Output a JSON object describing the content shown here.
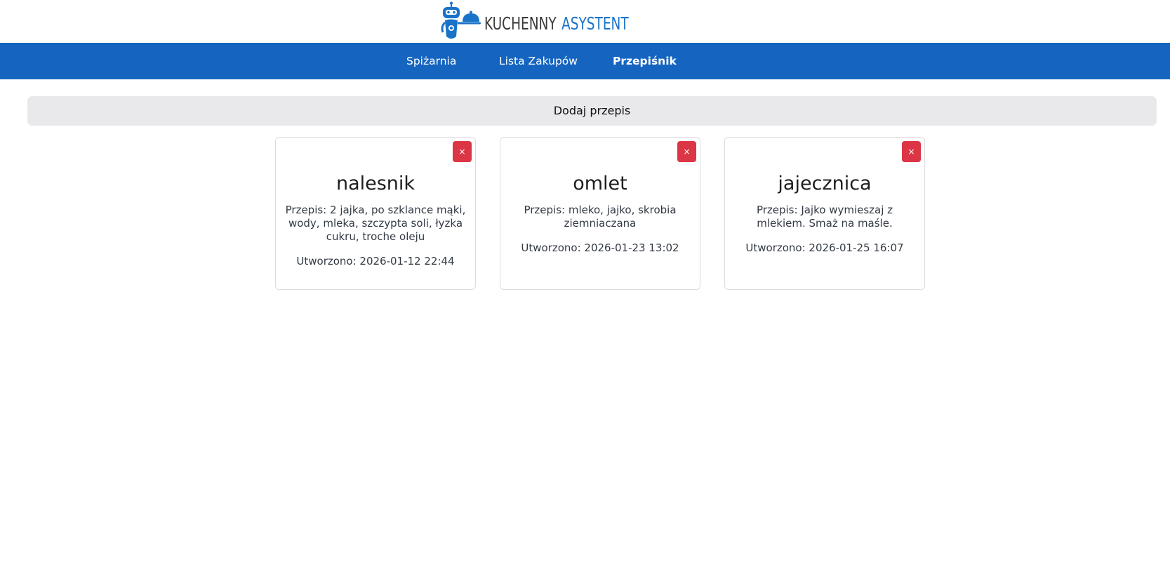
{
  "header": {
    "logo_word1": "KUCHENNY",
    "logo_word2": "ASYSTENT",
    "logo_icon": "robot-waiter-icon",
    "logo_colors": {
      "dark": "#3a3a3a",
      "accent": "#1a73c8"
    }
  },
  "nav": {
    "background": "#1565c0",
    "items": [
      {
        "label": "Spiżarnia",
        "active": false
      },
      {
        "label": "Lista Zakupów",
        "active": false
      },
      {
        "label": "Przepiśnik",
        "active": true
      }
    ]
  },
  "add_recipe": {
    "label": "Dodaj przepis"
  },
  "delete_color": "#dc3545",
  "recipes": [
    {
      "delete_label": "×",
      "title": "nalesnik",
      "recipe": "Przepis: 2 jajka, po szklance mąki, wody, mleka, szczypta soli, łyzka cukru, troche oleju",
      "created": "Utworzono: 2026-01-12 22:44"
    },
    {
      "delete_label": "×",
      "title": "omlet",
      "recipe": "Przepis: mleko, jajko, skrobia ziemniaczana",
      "created": "Utworzono: 2026-01-23 13:02"
    },
    {
      "delete_label": "×",
      "title": "jajecznica",
      "recipe": "Przepis: Jajko wymieszaj z mlekiem. Smaż na maśle.",
      "created": "Utworzono: 2026-01-25 16:07"
    }
  ]
}
